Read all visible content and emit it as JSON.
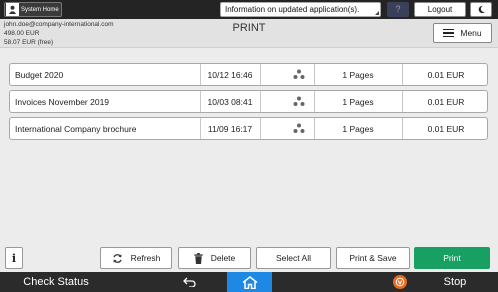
{
  "topbar": {
    "system_home_label": "System Home",
    "info_text": "Information on updated application(s).",
    "help_label": "?",
    "logout_label": "Logout"
  },
  "header": {
    "email": "john.doe@company-international.com",
    "balance": "498.00 EUR",
    "free_balance": "58.07 EUR (free)",
    "title": "PRINT",
    "menu_label": "Menu"
  },
  "jobs": [
    {
      "name": "Budget 2020",
      "date": "10/12 16:46",
      "pages": "1 Pages",
      "price": "0.01 EUR"
    },
    {
      "name": "Invoices November 2019",
      "date": "10/03 08:41",
      "pages": "1 Pages",
      "price": "0.01 EUR"
    },
    {
      "name": "International Company brochure",
      "date": "11/09 16:17",
      "pages": "1 Pages",
      "price": "0.01 EUR"
    }
  ],
  "toolbar": {
    "info_label": "i",
    "refresh_label": "Refresh",
    "delete_label": "Delete",
    "select_all_label": "Select All",
    "print_save_label": "Print & Save",
    "print_label": "Print"
  },
  "footer": {
    "check_status_label": "Check Status",
    "stop_label": "Stop"
  },
  "colors": {
    "print_button": "#17a062",
    "home_button": "#1e88e5",
    "stop_icon": "#e86b1f"
  }
}
